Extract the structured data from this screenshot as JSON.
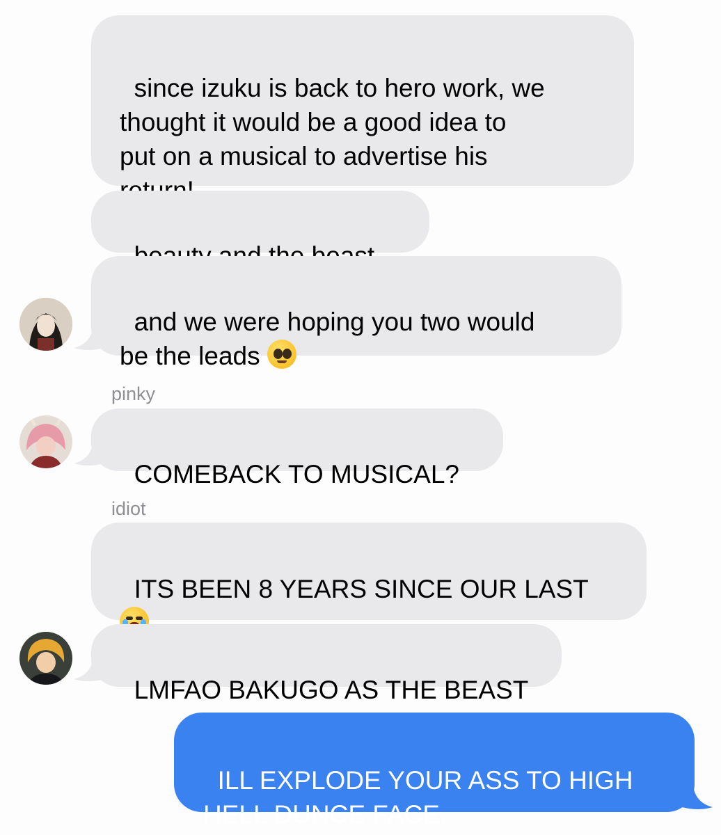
{
  "messages": [
    {
      "type": "received",
      "text": "since izuku is back to hero work, we\nthought it would be a good idea to\nput on a musical to advertise his\nreturn!"
    },
    {
      "type": "received",
      "text": "beauty and the beast"
    },
    {
      "type": "received",
      "text": "and we were hoping you two would\nbe the leads ",
      "emoji": "pleading-face-emoji"
    },
    {
      "type": "received",
      "sender": "pinky",
      "text": "COMEBACK TO MUSICAL?"
    },
    {
      "type": "received",
      "sender": "idiot",
      "text": "ITS BEEN 8 YEARS SINCE OUR LAST\n",
      "emoji": "loudly-crying-face-emoji"
    },
    {
      "type": "received",
      "text": "LMFAO BAKUGO AS THE BEAST"
    },
    {
      "type": "sent",
      "text": "ILL EXPLODE YOUR ASS TO HIGH\nHELL DUNCE FACE."
    }
  ],
  "colors": {
    "received_bubble": "#e9e9eb",
    "sent_bubble": "#3b82f1",
    "background": "#fdfdfd",
    "sender_label": "#8e8e93"
  },
  "avatars": [
    "avatar-dark-haired-character",
    "avatar-pink-haired-character",
    "avatar-blond-character"
  ]
}
